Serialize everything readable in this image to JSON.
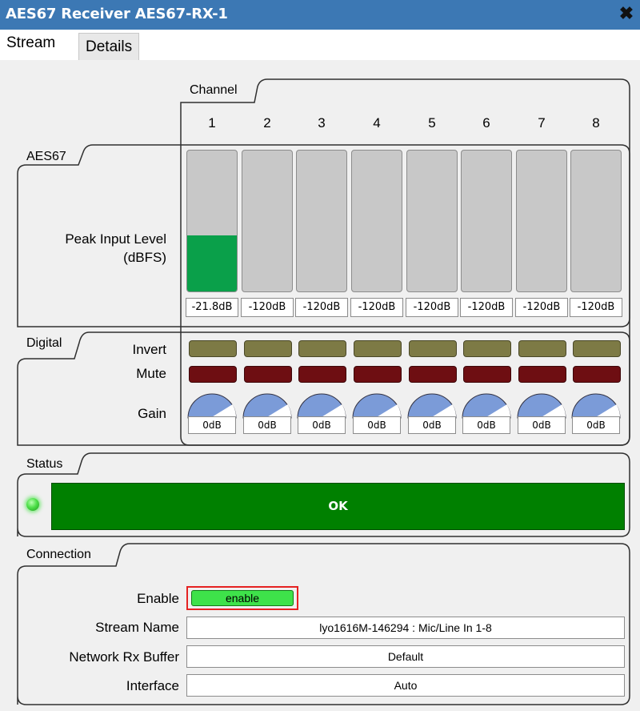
{
  "window": {
    "title": "AES67 Receiver AES67-RX-1",
    "close_icon": "close-icon"
  },
  "tabs": [
    {
      "label": "Stream",
      "active": true
    },
    {
      "label": "Details",
      "active": false
    }
  ],
  "groups": {
    "channel": "Channel",
    "aes67": "AES67",
    "digital": "Digital",
    "status": "Status",
    "connection": "Connection"
  },
  "channels": [
    "1",
    "2",
    "3",
    "4",
    "5",
    "6",
    "7",
    "8"
  ],
  "aes67": {
    "peak_label_line1": "Peak Input Level",
    "peak_label_line2": "(dBFS)",
    "meter_fill_fraction": [
      0.4,
      0,
      0,
      0,
      0,
      0,
      0,
      0
    ],
    "meter_values": [
      "-21.8dB",
      "-120dB",
      "-120dB",
      "-120dB",
      "-120dB",
      "-120dB",
      "-120dB",
      "-120dB"
    ],
    "meter_color": "#0aa04a"
  },
  "digital": {
    "invert_label": "Invert",
    "mute_label": "Mute",
    "gain_label": "Gain",
    "gain_values": [
      "0dB",
      "0dB",
      "0dB",
      "0dB",
      "0dB",
      "0dB",
      "0dB",
      "0dB"
    ],
    "invert_color": "#7d7a45",
    "mute_color": "#6e0e12",
    "knob_color": "#7b9bd8"
  },
  "status": {
    "text": "OK",
    "color": "#008000",
    "led_color": "#4fe04a"
  },
  "connection": {
    "enable_label": "Enable",
    "enable_button": "enable",
    "stream_name_label": "Stream Name",
    "stream_name": "lyo1616M-146294 : Mic/Line In 1-8",
    "network_rx_buffer_label": "Network Rx Buffer",
    "network_rx_buffer": "Default",
    "interface_label": "Interface",
    "interface": "Auto"
  }
}
